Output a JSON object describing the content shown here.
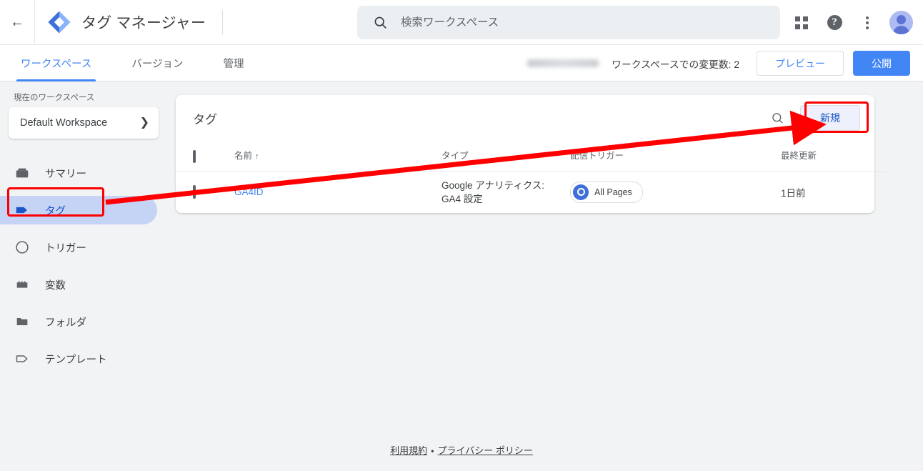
{
  "header": {
    "back_icon": "back-arrow-icon",
    "logo_icon": "google-tag-manager-logo",
    "title": "タグ マネージャー",
    "account_masked": "",
    "search": {
      "icon": "search-icon",
      "placeholder": "検索ワークスペース",
      "value": ""
    },
    "apps_icon": "apps-grid-icon",
    "help_icon": "help-circle-icon",
    "more_icon": "kebab-menu-icon",
    "avatar": "user-avatar"
  },
  "tabbar": {
    "tabs": [
      {
        "label": "ワークスペース",
        "active": true
      },
      {
        "label": "バージョン",
        "active": false
      },
      {
        "label": "管理",
        "active": false
      }
    ],
    "changes_label": "ワークスペースでの変更数: 2",
    "preview_label": "プレビュー",
    "publish_label": "公開"
  },
  "sidebar": {
    "workspace_label": "現在のワークスペース",
    "workspace_name": "Default Workspace",
    "workspace_chevron": "chevron-right-icon",
    "items": [
      {
        "label": "サマリー",
        "icon": "summary-icon",
        "selected": false
      },
      {
        "label": "タグ",
        "icon": "tag-icon",
        "selected": true
      },
      {
        "label": "トリガー",
        "icon": "trigger-icon",
        "selected": false
      },
      {
        "label": "変数",
        "icon": "variable-icon",
        "selected": false
      },
      {
        "label": "フォルダ",
        "icon": "folder-icon",
        "selected": false
      },
      {
        "label": "テンプレート",
        "icon": "template-icon",
        "selected": false
      }
    ]
  },
  "card": {
    "title": "タグ",
    "search_icon": "search-icon",
    "new_button": "新規",
    "columns": [
      {
        "key": "check",
        "label": ""
      },
      {
        "key": "name",
        "label": "名前",
        "sort": "↑"
      },
      {
        "key": "type",
        "label": "タイプ"
      },
      {
        "key": "trigger",
        "label": "配信トリガー"
      },
      {
        "key": "updated",
        "label": "最終更新"
      }
    ],
    "rows": [
      {
        "name": "GA4ID",
        "type_line1": "Google アナリティクス:",
        "type_line2": "GA4 設定",
        "trigger": "All Pages",
        "trigger_icon": "trigger-circle-icon",
        "updated": "1日前"
      }
    ]
  },
  "footer": {
    "terms": "利用規約",
    "separator": "・",
    "privacy": "プライバシー ポリシー"
  },
  "annotations": {
    "color": "#ff0000",
    "arrow": {
      "from": "sidebar-item-tag",
      "to": "new-tag-button"
    },
    "boxes": [
      "sidebar-item-tag",
      "new-tag-button"
    ]
  }
}
